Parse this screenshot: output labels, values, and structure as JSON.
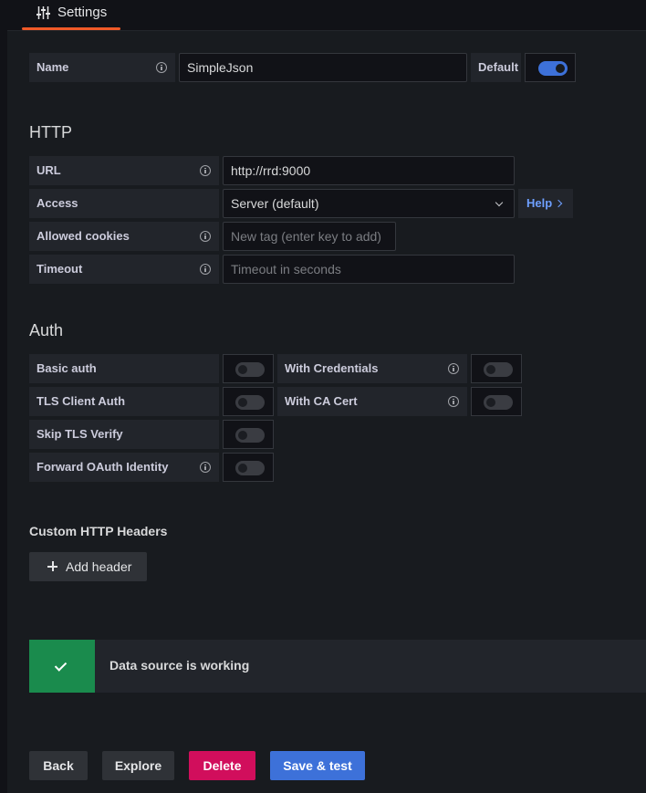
{
  "tab": {
    "label": "Settings",
    "icon": "sliders-icon"
  },
  "name_row": {
    "label": "Name",
    "value": "SimpleJson",
    "default_label": "Default",
    "default_on": true
  },
  "http": {
    "title": "HTTP",
    "url_label": "URL",
    "url_value": "http://rrd:9000",
    "access_label": "Access",
    "access_value": "Server (default)",
    "help_label": "Help",
    "cookies_label": "Allowed cookies",
    "cookies_placeholder": "New tag (enter key to add)",
    "timeout_label": "Timeout",
    "timeout_placeholder": "Timeout in seconds"
  },
  "auth": {
    "title": "Auth",
    "basic_auth": "Basic auth",
    "with_credentials": "With Credentials",
    "tls_client_auth": "TLS Client Auth",
    "with_ca_cert": "With CA Cert",
    "skip_tls_verify": "Skip TLS Verify",
    "forward_oauth": "Forward OAuth Identity"
  },
  "headers": {
    "title": "Custom HTTP Headers",
    "add_label": "Add header"
  },
  "alert": {
    "message": "Data source is working"
  },
  "actions": {
    "back": "Back",
    "explore": "Explore",
    "delete": "Delete",
    "save": "Save & test"
  },
  "colors": {
    "accent": "#f05a28",
    "primary": "#3d71d9",
    "danger": "#d10e5c",
    "success": "#1a8b4d",
    "link": "#6e9fff"
  }
}
